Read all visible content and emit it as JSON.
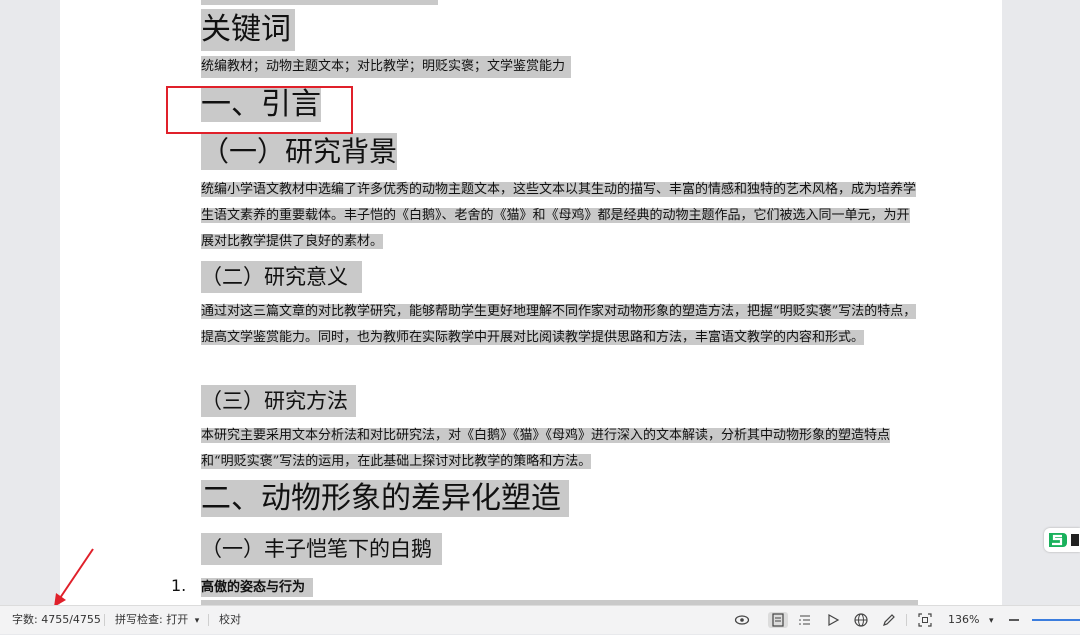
{
  "document": {
    "keywords_heading": "关键词",
    "keywords_text": "统编教材；动物主题文本；对比教学；明贬实褒；文学鉴赏能力",
    "h1_intro": "一、引言",
    "h2_background": "（一）研究背景",
    "p_background": "统编小学语文教材中选编了许多优秀的动物主题文本，这些文本以其生动的描写、丰富的情感和独特的艺术风格，成为培养学生语文素养的重要载体。丰子恺的《白鹅》、老舍的《猫》和《母鸡》都是经典的动物主题作品，它们被选入同一单元，为开展对比教学提供了良好的素材。",
    "h2_significance": "（二）研究意义",
    "p_significance": "通过对这三篇文章的对比教学研究，能够帮助学生更好地理解不同作家对动物形象的塑造方法，把握“明贬实褒”写法的特点，提高文学鉴赏能力。同时，也为教师在实际教学中开展对比阅读教学提供思路和方法，丰富语文教学的内容和形式。",
    "h2_method": "（三）研究方法",
    "p_method": "本研究主要采用文本分析法和对比研究法，对《白鹅》《猫》《母鸡》进行深入的文本解读，分析其中动物形象的塑造特点和“明贬实褒”写法的运用，在此基础上探讨对比教学的策略和方法。",
    "h1_animals": "二、动物形象的差异化塑造",
    "h2_feng": "（一）丰子恺笔下的白鹅",
    "list_number": "1.",
    "list_item": "高傲的姿态与行为"
  },
  "statusbar": {
    "word_count": "字数: 4755/4755",
    "spell_check": "拼写检查: 打开",
    "proofread": "校对",
    "zoom": "136%",
    "icons": [
      "eye-icon",
      "page-view-icon",
      "outline-view-icon",
      "play-icon",
      "globe-icon",
      "pen-icon",
      "fit-page-icon",
      "zoom-out-icon"
    ]
  },
  "colors": {
    "selection": "#c9c9c9",
    "annotation_red": "#e0202a",
    "zoom_slider": "#3b7dde"
  }
}
